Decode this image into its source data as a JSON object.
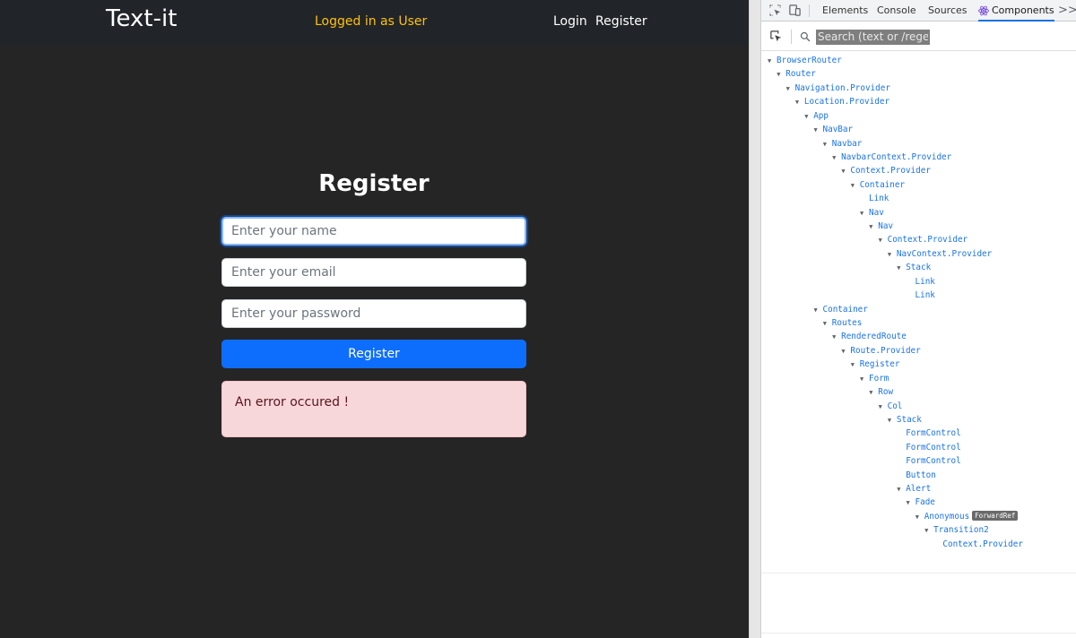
{
  "app": {
    "brand": "Text-it",
    "status": "Logged in as User",
    "nav": {
      "login": "Login",
      "register": "Register"
    },
    "form": {
      "title": "Register",
      "name_placeholder": "Enter your name",
      "email_placeholder": "Enter your email",
      "password_placeholder": "Enter your password",
      "submit_label": "Register",
      "error": "An error occured !"
    },
    "colors": {
      "accent": "#0d6efd",
      "status": "#ffc107",
      "alert_bg": "#f8d7da",
      "background": "#252525",
      "navbar": "#212529"
    }
  },
  "devtools": {
    "icons": [
      "inspect-element-icon",
      "device-toolbar-icon",
      "react-icon",
      "more-tabs-icon",
      "select-component-icon",
      "search-icon"
    ],
    "tabs": {
      "elements": "Elements",
      "console": "Console",
      "sources": "Sources",
      "components": "Components",
      "more": ">>"
    },
    "active_tab": "Components",
    "search_placeholder": "Search (text or /regex/)",
    "tree": [
      {
        "label": "BrowserRouter",
        "depth": 0,
        "expanded": true
      },
      {
        "label": "Router",
        "depth": 1,
        "expanded": true
      },
      {
        "label": "Navigation.Provider",
        "depth": 2,
        "expanded": true
      },
      {
        "label": "Location.Provider",
        "depth": 3,
        "expanded": true
      },
      {
        "label": "App",
        "depth": 4,
        "expanded": true
      },
      {
        "label": "NavBar",
        "depth": 5,
        "expanded": true
      },
      {
        "label": "Navbar",
        "depth": 6,
        "expanded": true
      },
      {
        "label": "NavbarContext.Provider",
        "depth": 7,
        "expanded": true
      },
      {
        "label": "Context.Provider",
        "depth": 8,
        "expanded": true
      },
      {
        "label": "Container",
        "depth": 9,
        "expanded": true
      },
      {
        "label": "Link",
        "depth": 10,
        "expanded": false
      },
      {
        "label": "Nav",
        "depth": 10,
        "expanded": true
      },
      {
        "label": "Nav",
        "depth": 11,
        "expanded": true
      },
      {
        "label": "Context.Provider",
        "depth": 12,
        "expanded": true
      },
      {
        "label": "NavContext.Provider",
        "depth": 13,
        "expanded": true
      },
      {
        "label": "Stack",
        "depth": 14,
        "expanded": true
      },
      {
        "label": "Link",
        "depth": 15,
        "expanded": false
      },
      {
        "label": "Link",
        "depth": 15,
        "expanded": false
      },
      {
        "label": "Container",
        "depth": 5,
        "expanded": true
      },
      {
        "label": "Routes",
        "depth": 6,
        "expanded": true
      },
      {
        "label": "RenderedRoute",
        "depth": 7,
        "expanded": true
      },
      {
        "label": "Route.Provider",
        "depth": 8,
        "expanded": true
      },
      {
        "label": "Register",
        "depth": 9,
        "expanded": true
      },
      {
        "label": "Form",
        "depth": 10,
        "expanded": true
      },
      {
        "label": "Row",
        "depth": 11,
        "expanded": true
      },
      {
        "label": "Col",
        "depth": 12,
        "expanded": true
      },
      {
        "label": "Stack",
        "depth": 13,
        "expanded": true
      },
      {
        "label": "FormControl",
        "depth": 14,
        "expanded": false
      },
      {
        "label": "FormControl",
        "depth": 14,
        "expanded": false
      },
      {
        "label": "FormControl",
        "depth": 14,
        "expanded": false
      },
      {
        "label": "Button",
        "depth": 14,
        "expanded": false
      },
      {
        "label": "Alert",
        "depth": 14,
        "expanded": true
      },
      {
        "label": "Fade",
        "depth": 15,
        "expanded": true
      },
      {
        "label": "Anonymous",
        "depth": 16,
        "expanded": true,
        "badge": "ForwardRef"
      },
      {
        "label": "Transition2",
        "depth": 17,
        "expanded": true
      },
      {
        "label": "Context.Provider",
        "depth": 18,
        "expanded": false
      }
    ]
  }
}
